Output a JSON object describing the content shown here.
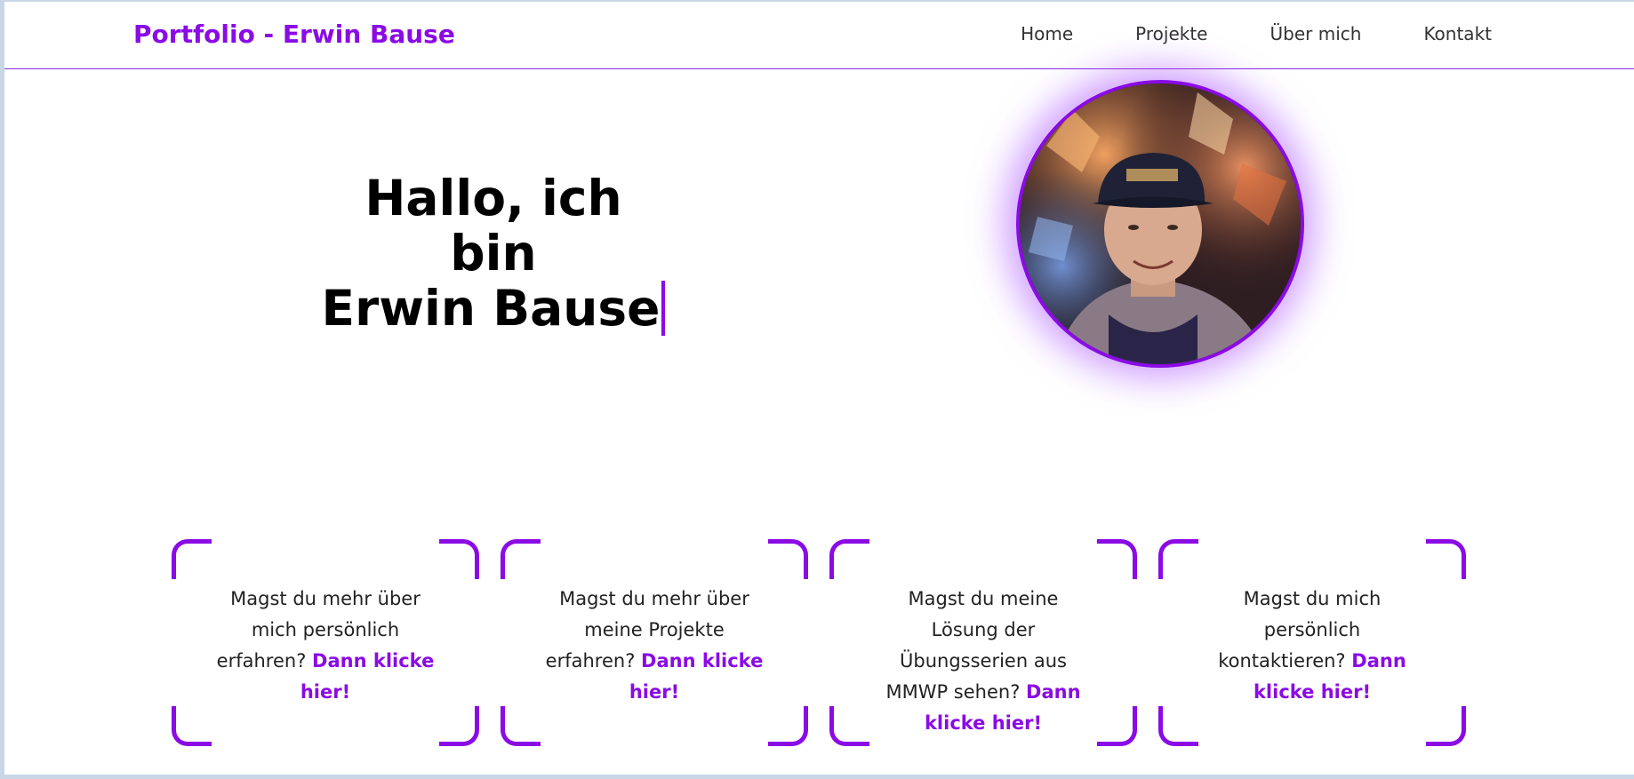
{
  "navbar": {
    "brand": "Portfolio - Erwin Bause",
    "links": [
      "Home",
      "Projekte",
      "Über mich",
      "Kontakt"
    ]
  },
  "hero": {
    "line1": "Hallo, ich bin",
    "line2": "Erwin Bause"
  },
  "cards": [
    {
      "text": "Magst du mehr über mich persönlich erfahren?",
      "link": "Dann klicke hier!"
    },
    {
      "text": "Magst du mehr über meine Projekte erfahren?",
      "link": "Dann klicke hier!"
    },
    {
      "text": "Magst du meine Lösung der Übungsserien aus MMWP sehen?",
      "link": "Dann klicke hier!"
    },
    {
      "text": "Magst du mich persönlich kontaktieren?",
      "link": "Dann klicke hier!"
    }
  ],
  "colors": {
    "accent": "#8a0be5"
  }
}
